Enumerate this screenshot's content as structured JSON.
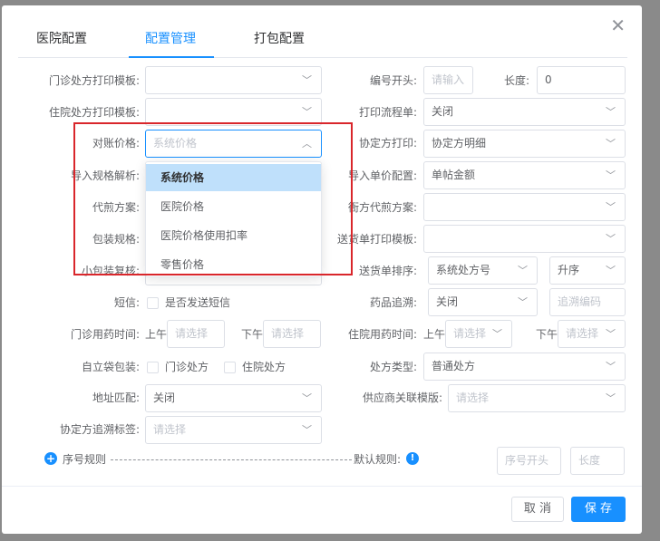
{
  "dialog": {
    "tabs": [
      "医院配置",
      "配置管理",
      "打包配置"
    ],
    "active_tab": 1
  },
  "left": {
    "clinic_print_template": {
      "label": "门诊处方打印模板:",
      "value": ""
    },
    "inpatient_print_template": {
      "label": "住院处方打印模板:",
      "value": ""
    },
    "reconcile_price": {
      "label": "对账价格:",
      "placeholder": "系统价格"
    },
    "import_spec_parse": {
      "label": "导入规格解析:"
    },
    "decoct_plan": {
      "label": "代煎方案:"
    },
    "package_spec": {
      "label": "包装规格:"
    },
    "small_pack_review": {
      "label": "小包装复核:"
    },
    "sms": {
      "label": "短信:",
      "checkbox": "是否发送短信"
    },
    "clinic_med_time": {
      "label": "门诊用药时间:",
      "am": "上午",
      "pm": "下午",
      "placeholder": "请选择"
    },
    "self_bag_pack": {
      "label": "自立袋包装:",
      "opt1": "门诊处方",
      "opt2": "住院处方"
    },
    "address_match": {
      "label": "地址匹配:",
      "value": "关闭"
    },
    "agreement_trace_tag": {
      "label": "协定方追溯标签:",
      "placeholder": "请选择"
    }
  },
  "right": {
    "number_prefix": {
      "label": "编号开头:",
      "placeholder": "请输入",
      "length_label": "长度:",
      "length_value": "0"
    },
    "print_flow": {
      "label": "打印流程单:",
      "value": "关闭"
    },
    "agreement_print": {
      "label": "协定方打印:",
      "value": "协定方明细"
    },
    "import_unit_price": {
      "label": "导入单价配置:",
      "value": "单帖金额"
    },
    "clinic_decoct_plan": {
      "label": "衙方代煎方案:",
      "value": ""
    },
    "delivery_print_template": {
      "label": "送货单打印模板:",
      "value": ""
    },
    "delivery_sort": {
      "label": "送货单排序:",
      "value": "系统处方号",
      "order": "升序"
    },
    "drug_trace": {
      "label": "药品追溯:",
      "value": "关闭",
      "placeholder": "追溯编码"
    },
    "inpatient_med_time": {
      "label": "住院用药时间:",
      "am": "上午",
      "pm": "下午",
      "placeholder": "请选择"
    },
    "rx_type": {
      "label": "处方类型:",
      "value": "普通处方"
    },
    "supplier_template": {
      "label": "供应商关联模版:",
      "placeholder": "请选择"
    }
  },
  "serial_rule": {
    "label": "序号规则",
    "default_label": "默认规则:",
    "start_placeholder": "序号开头",
    "length_placeholder": "长度"
  },
  "dropdown": {
    "options": [
      "系统价格",
      "医院价格",
      "医院价格使用扣率",
      "零售价格"
    ],
    "selected": 0
  },
  "buttons": {
    "cancel": "取 消",
    "save": "保 存"
  },
  "icons": {
    "close": "close-icon",
    "chevron": "chevron-down-icon",
    "plus": "plus-circle-icon",
    "info": "info-icon"
  },
  "colors": {
    "accent": "#1890ff",
    "highlight": "#d9262b"
  }
}
